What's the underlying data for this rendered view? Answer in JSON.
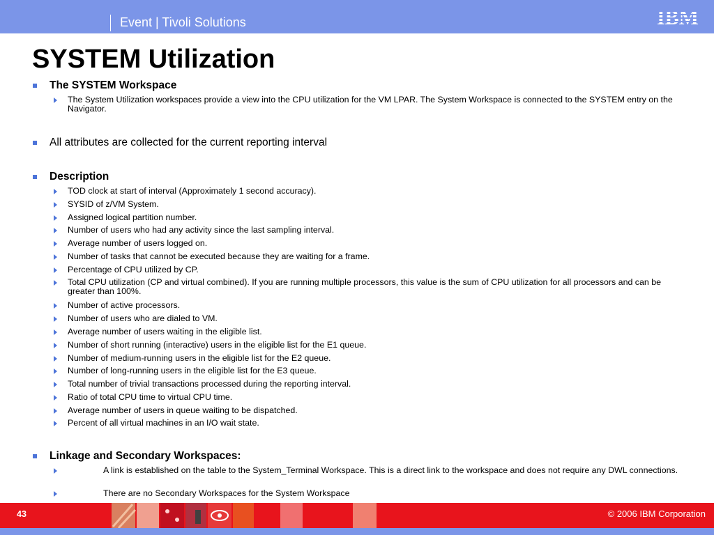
{
  "header": {
    "title": "Event | Tivoli Solutions",
    "logo_text": "IBM"
  },
  "slide": {
    "title": "SYSTEM Utilization",
    "workspace_heading": "The SYSTEM Workspace",
    "workspace_text": "The System Utilization workspaces provide a view into the CPU utilization for the VM LPAR.  The System Workspace is connected to the SYSTEM entry on the Navigator.",
    "attributes_text": "All attributes are collected for the current reporting interval",
    "description_heading": "Description",
    "description_items": [
      "TOD clock at start of interval (Approximately 1 second accuracy).",
      "SYSID of z/VM System.",
      "Assigned logical partition number.",
      "Number of users who had any activity since the last sampling interval.",
      "Average number of users logged on.",
      "Number of tasks that cannot be executed because they are waiting for a frame.",
      "Percentage of CPU utilized by CP.",
      "Total CPU utilization (CP and virtual combined). If you are running multiple processors, this value is the sum of CPU utilization for all processors and can be greater than 100%.",
      "Number of active processors.",
      "Number of users who are dialed to VM.",
      "Average number of users waiting in the eligible list.",
      "Number of short running (interactive) users in the eligible list for the E1 queue.",
      "Number of medium-running users in the eligible list for the E2 queue.",
      "Number of long-running users in the eligible list for the E3 queue.",
      "Total number of trivial transactions processed during the reporting interval.",
      "Ratio of total CPU time to virtual CPU time.",
      "Average number of users in queue waiting to be dispatched.",
      "Percent of all virtual machines in an I/O wait state."
    ],
    "linkage_heading": "Linkage and Secondary Workspaces:",
    "linkage_items": [
      "A link is established on the table to the System_Terminal Workspace. This is a direct link to the workspace and does not require any DWL connections.",
      "There are no Secondary Workspaces for the System Workspace"
    ]
  },
  "footer": {
    "page_number": "43",
    "copyright": "© 2006 IBM Corporation"
  },
  "colors": {
    "header_blue": "#7b95e8",
    "footer_red": "#e8141c",
    "bullet_blue": "#4d74d9"
  }
}
